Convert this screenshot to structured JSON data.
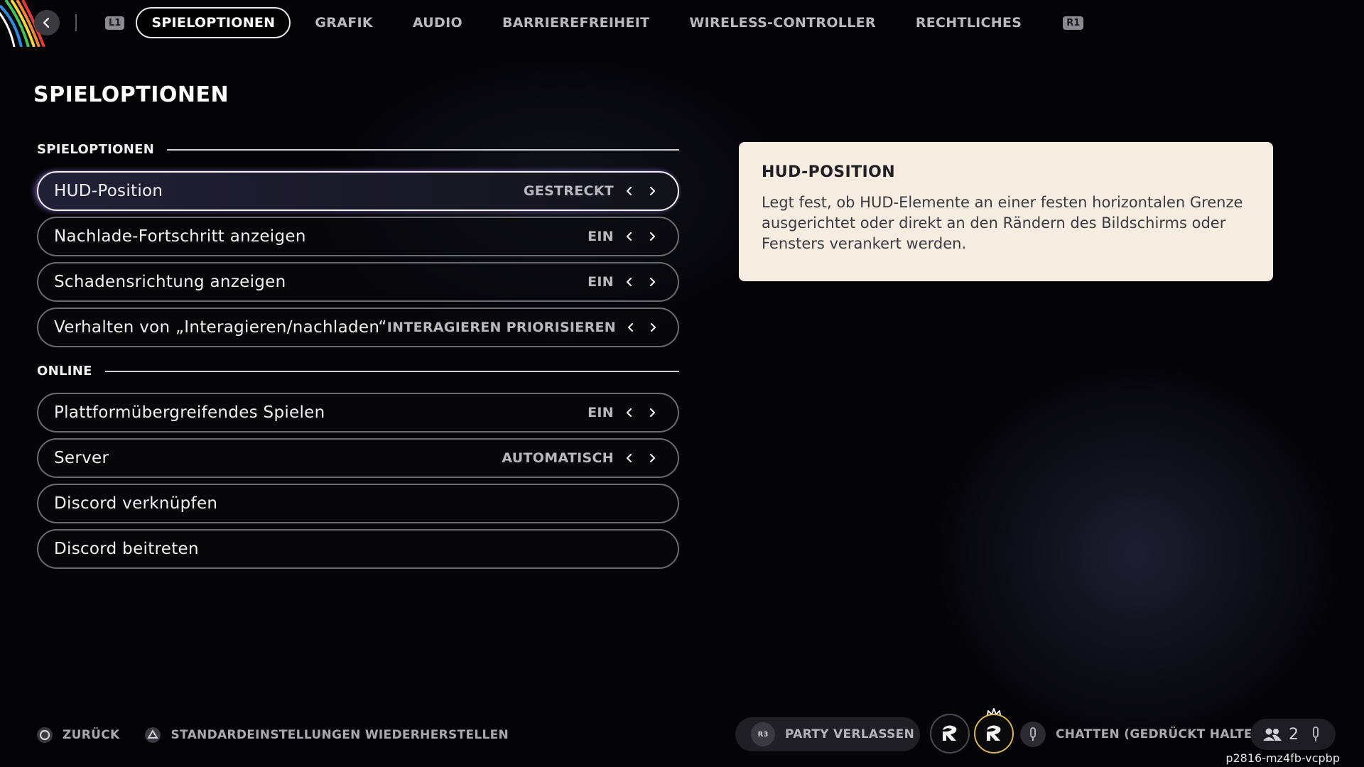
{
  "nav": {
    "l1_tag": "L1",
    "r1_tag": "R1",
    "tabs": [
      {
        "label": "SPIELOPTIONEN",
        "active": true
      },
      {
        "label": "GRAFIK"
      },
      {
        "label": "AUDIO"
      },
      {
        "label": "BARRIEREFREIHEIT"
      },
      {
        "label": "WIRELESS-CONTROLLER"
      },
      {
        "label": "RECHTLICHES"
      }
    ]
  },
  "page_title": "SPIELOPTIONEN",
  "sections": [
    {
      "label": "SPIELOPTIONEN",
      "rows": [
        {
          "label": "HUD-Position",
          "value": "GESTRECKT",
          "selected": true
        },
        {
          "label": "Nachlade-Fortschritt anzeigen",
          "value": "EIN"
        },
        {
          "label": "Schadensrichtung anzeigen",
          "value": "EIN"
        },
        {
          "label": "Verhalten von „Interagieren/nachladen“",
          "value": "INTERAGIEREN PRIORISIEREN"
        }
      ]
    },
    {
      "label": "ONLINE",
      "rows": [
        {
          "label": "Plattformübergreifendes Spielen",
          "value": "EIN"
        },
        {
          "label": "Server",
          "value": "AUTOMATISCH"
        },
        {
          "label": "Discord verknüpfen"
        },
        {
          "label": "Discord beitreten"
        }
      ]
    }
  ],
  "info": {
    "title": "HUD-POSITION",
    "description": "Legt fest, ob HUD-Elemente an einer festen horizontalen Grenze ausgerichtet oder direkt an den Rändern des Bildschirms oder Fensters verankert werden."
  },
  "bottom": {
    "back_label": "ZURÜCK",
    "reset_label": "STANDARDEINSTELLUNGEN WIEDERHERSTELLEN",
    "party_button_tag": "R3",
    "party_leave_label": "PARTY VERLASSEN",
    "chat_label": "CHATTEN (GEDRÜCKT HALTEN)",
    "party_count": "2",
    "session_id": "p2816-mz4fb-vcpbp"
  },
  "colors": {
    "background": "#040406",
    "info_panel": "#f6ece0",
    "selected_glow": "#9a6ee6",
    "ready_ring": "#d9b45a"
  }
}
